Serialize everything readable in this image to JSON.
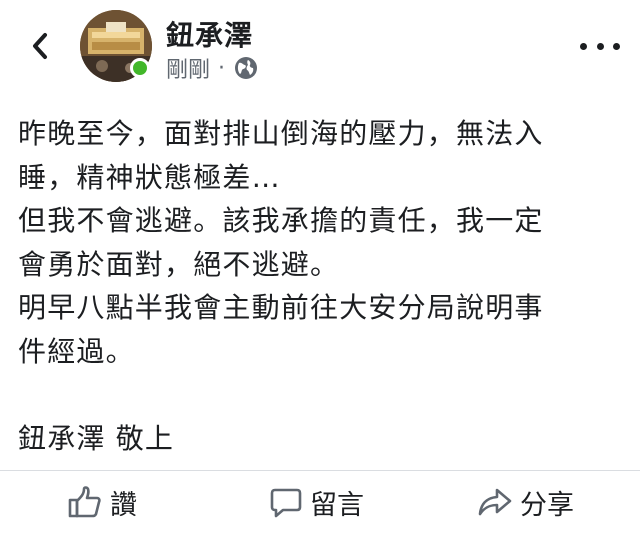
{
  "post": {
    "author_name": "鈕承澤",
    "timestamp": "剛剛",
    "separator": "·",
    "privacy_icon": "globe-icon",
    "author_online": true,
    "body_lines": [
      "昨晚至今，面對排山倒海的壓力，無法入",
      "睡，精神狀態極差…",
      "但我不會逃避。該我承擔的責任，我一定",
      "會勇於面對，絕不逃避。",
      "明早八點半我會主動前往大安分局說明事",
      "件經過。",
      "",
      "鈕承澤  敬上"
    ]
  },
  "nav": {
    "back_icon": "chevron-left-icon",
    "more_icon": "more-horizontal-icon"
  },
  "actions": {
    "like_label": "讚",
    "comment_label": "留言",
    "share_label": "分享"
  },
  "colors": {
    "text": "#1c1e21",
    "secondary_text": "#606770",
    "online": "#42b72a",
    "divider": "#dadde1"
  }
}
